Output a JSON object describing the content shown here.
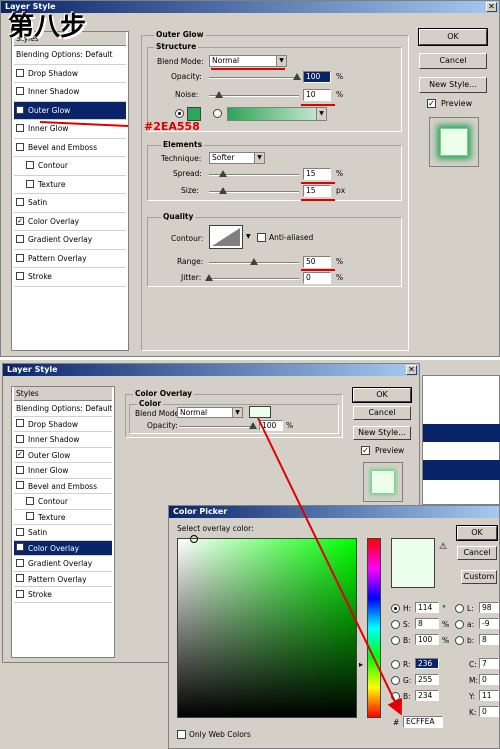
{
  "overlay_title": "第八步",
  "annotation_color": "#2EA558",
  "dialog1": {
    "title": "Layer Style",
    "styles_header": "Styles",
    "styles": [
      {
        "label": "Blending Options: Default",
        "checkbox": false,
        "checked": false,
        "selected": false
      },
      {
        "label": "Drop Shadow",
        "checkbox": true,
        "checked": false,
        "selected": false
      },
      {
        "label": "Inner Shadow",
        "checkbox": true,
        "checked": false,
        "selected": false
      },
      {
        "label": "Outer Glow",
        "checkbox": true,
        "checked": true,
        "selected": true
      },
      {
        "label": "Inner Glow",
        "checkbox": true,
        "checked": false,
        "selected": false
      },
      {
        "label": "Bevel and Emboss",
        "checkbox": true,
        "checked": false,
        "selected": false
      },
      {
        "label": "Contour",
        "checkbox": true,
        "checked": false,
        "selected": false,
        "sub": true
      },
      {
        "label": "Texture",
        "checkbox": true,
        "checked": false,
        "selected": false,
        "sub": true
      },
      {
        "label": "Satin",
        "checkbox": true,
        "checked": false,
        "selected": false
      },
      {
        "label": "Color Overlay",
        "checkbox": true,
        "checked": true,
        "selected": false
      },
      {
        "label": "Gradient Overlay",
        "checkbox": true,
        "checked": false,
        "selected": false
      },
      {
        "label": "Pattern Overlay",
        "checkbox": true,
        "checked": false,
        "selected": false
      },
      {
        "label": "Stroke",
        "checkbox": true,
        "checked": false,
        "selected": false
      }
    ],
    "section_title": "Outer Glow",
    "structure_label": "Structure",
    "blend_mode_label": "Blend Mode:",
    "blend_mode_value": "Normal",
    "opacity_label": "Opacity:",
    "opacity_value": "100",
    "noise_label": "Noise:",
    "noise_value": "10",
    "percent": "%",
    "elements_label": "Elements",
    "technique_label": "Technique:",
    "technique_value": "Softer",
    "spread_label": "Spread:",
    "spread_value": "15",
    "size_label": "Size:",
    "size_value": "15",
    "px": "px",
    "quality_label": "Quality",
    "contour_label": "Contour:",
    "antialiased_label": "Anti-aliased",
    "range_label": "Range:",
    "range_value": "50",
    "jitter_label": "Jitter:",
    "jitter_value": "0",
    "ok": "OK",
    "cancel": "Cancel",
    "new_style": "New Style...",
    "preview": "Preview",
    "glow_color": "#2EA558",
    "preview_fill": "#ECFFEA"
  },
  "dialog2": {
    "title": "Layer Style",
    "styles_header": "Styles",
    "styles": [
      {
        "label": "Blending Options: Default",
        "checkbox": false,
        "checked": false,
        "selected": false
      },
      {
        "label": "Drop Shadow",
        "checkbox": true,
        "checked": false,
        "selected": false
      },
      {
        "label": "Inner Shadow",
        "checkbox": true,
        "checked": false,
        "selected": false
      },
      {
        "label": "Outer Glow",
        "checkbox": true,
        "checked": true,
        "selected": false
      },
      {
        "label": "Inner Glow",
        "checkbox": true,
        "checked": false,
        "selected": false
      },
      {
        "label": "Bevel and Emboss",
        "checkbox": true,
        "checked": false,
        "selected": false
      },
      {
        "label": "Contour",
        "checkbox": true,
        "checked": false,
        "selected": false,
        "sub": true
      },
      {
        "label": "Texture",
        "checkbox": true,
        "checked": false,
        "selected": false,
        "sub": true
      },
      {
        "label": "Satin",
        "checkbox": true,
        "checked": false,
        "selected": false
      },
      {
        "label": "Color Overlay",
        "checkbox": true,
        "checked": true,
        "selected": true
      },
      {
        "label": "Gradient Overlay",
        "checkbox": true,
        "checked": false,
        "selected": false
      },
      {
        "label": "Pattern Overlay",
        "checkbox": true,
        "checked": false,
        "selected": false
      },
      {
        "label": "Stroke",
        "checkbox": true,
        "checked": false,
        "selected": false
      }
    ],
    "section_title": "Color Overlay",
    "color_label": "Color",
    "blend_mode_label": "Blend Mode:",
    "blend_mode_value": "Normal",
    "opacity_label": "Opacity:",
    "opacity_value": "100",
    "percent": "%",
    "ok": "OK",
    "cancel": "Cancel",
    "new_style": "New Style...",
    "preview": "Preview",
    "overlay_color": "#ECFFEA"
  },
  "color_picker": {
    "title": "Color Picker",
    "prompt": "Select overlay color:",
    "ok": "OK",
    "cancel": "Cancel",
    "custom": "Custom",
    "only_web_colors": "Only Web Colors",
    "h_label": "H:",
    "h_value": "114",
    "h_unit": "°",
    "s_label": "S:",
    "s_value": "8",
    "s_unit": "%",
    "b_label": "B:",
    "b_value": "100",
    "b_unit": "%",
    "r_label": "R:",
    "r_value": "236",
    "g_label": "G:",
    "g_value": "255",
    "b2_label": "B:",
    "b2_value": "234",
    "l_label": "L:",
    "l_value": "98",
    "a_label": "a:",
    "a_value": "-9",
    "b3_label": "b:",
    "b3_value": "8",
    "c_label": "C:",
    "c_value": "7",
    "m_label": "M:",
    "m_value": "0",
    "y_label": "Y:",
    "y_value": "11",
    "k_label": "K:",
    "k_value": "0",
    "hex_label": "#",
    "hex_value": "ECFFEA",
    "new_color": "#ECFFEA",
    "field_hue": "#00FF00"
  }
}
